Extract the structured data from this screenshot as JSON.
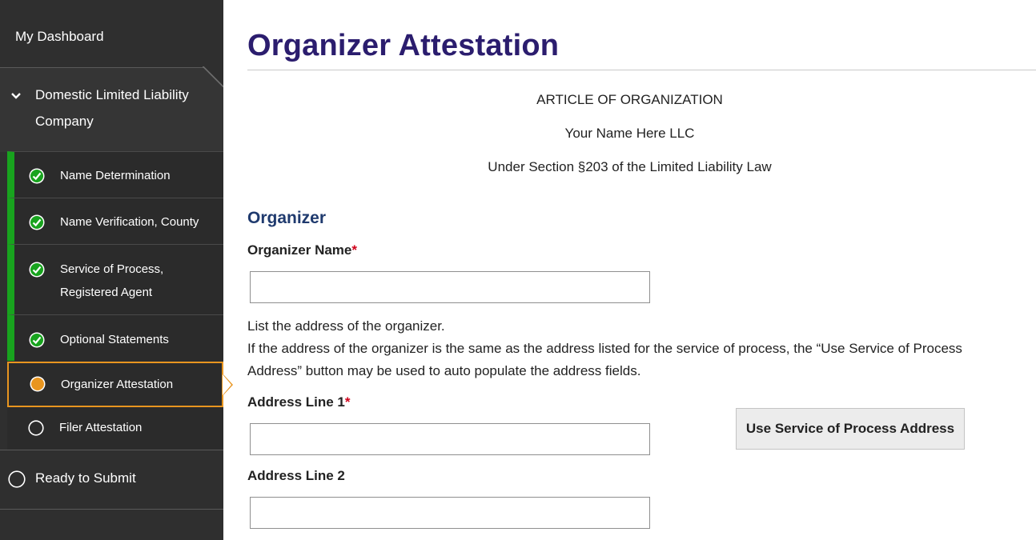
{
  "sidebar": {
    "dashboard_label": "My Dashboard",
    "section_label": "Domestic Limited Liability Company",
    "steps": [
      {
        "label": "Name Determination",
        "status": "complete"
      },
      {
        "label": "Name Verification, County",
        "status": "complete"
      },
      {
        "label": "Service of Process, Registered Agent",
        "status": "complete"
      },
      {
        "label": "Optional Statements",
        "status": "complete"
      },
      {
        "label": "Organizer Attestation",
        "status": "current"
      },
      {
        "label": "Filer Attestation",
        "status": "pending"
      }
    ],
    "ready_label": "Ready to Submit"
  },
  "main": {
    "title": "Organizer Attestation",
    "header_lines": [
      "ARTICLE OF ORGANIZATION",
      "Your Name Here LLC",
      "Under Section §203 of the Limited Liability Law"
    ],
    "section_heading": "Organizer",
    "organizer_name_label": "Organizer Name",
    "required_mark": "*",
    "organizer_name_value": "",
    "info_line_1": "List the address of the organizer.",
    "info_line_2": "If the address of the organizer is the same as the address listed for the service of process, the “Use Service of Process Address” button may be used to auto populate the address fields.",
    "address1_label": "Address Line 1",
    "address1_value": "",
    "address2_label": "Address Line 2",
    "address2_value": "",
    "use_sop_button": "Use Service of Process Address"
  },
  "colors": {
    "sidebar_bg": "#2f2f2f",
    "complete_green": "#18a31e",
    "current_orange": "#e8951f",
    "title_purple": "#2b1d6e",
    "section_blue": "#1f3a6e",
    "required_red": "#d0021b"
  },
  "icons": {
    "complete": "check-circle-icon",
    "current": "current-step-icon",
    "pending": "empty-circle-icon",
    "section_toggle": "chevron-down-icon"
  }
}
